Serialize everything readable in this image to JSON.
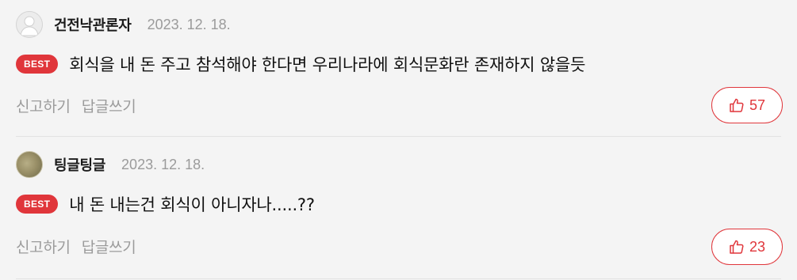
{
  "comments": [
    {
      "avatar": "default-avatar",
      "username": "건전낙관론자",
      "date": "2023. 12. 18.",
      "badge": "BEST",
      "text": "회식을 내 돈 주고 참석해야 한다면 우리나라에 회식문화란 존재하지 않을듯",
      "actions": {
        "report": "신고하기",
        "reply": "답글쓰기"
      },
      "likes": "57",
      "like_icon": "thumbs-up-icon"
    },
    {
      "avatar": "photo-avatar",
      "username": "팅글팅글",
      "date": "2023. 12. 18.",
      "badge": "BEST",
      "text": "내 돈 내는건 회식이 아니자나.....??",
      "actions": {
        "report": "신고하기",
        "reply": "답글쓰기"
      },
      "likes": "23",
      "like_icon": "thumbs-up-icon"
    }
  ],
  "colors": {
    "accent": "#e0363b",
    "muted_text": "#9b9b9b",
    "background": "#f4f4f4"
  }
}
